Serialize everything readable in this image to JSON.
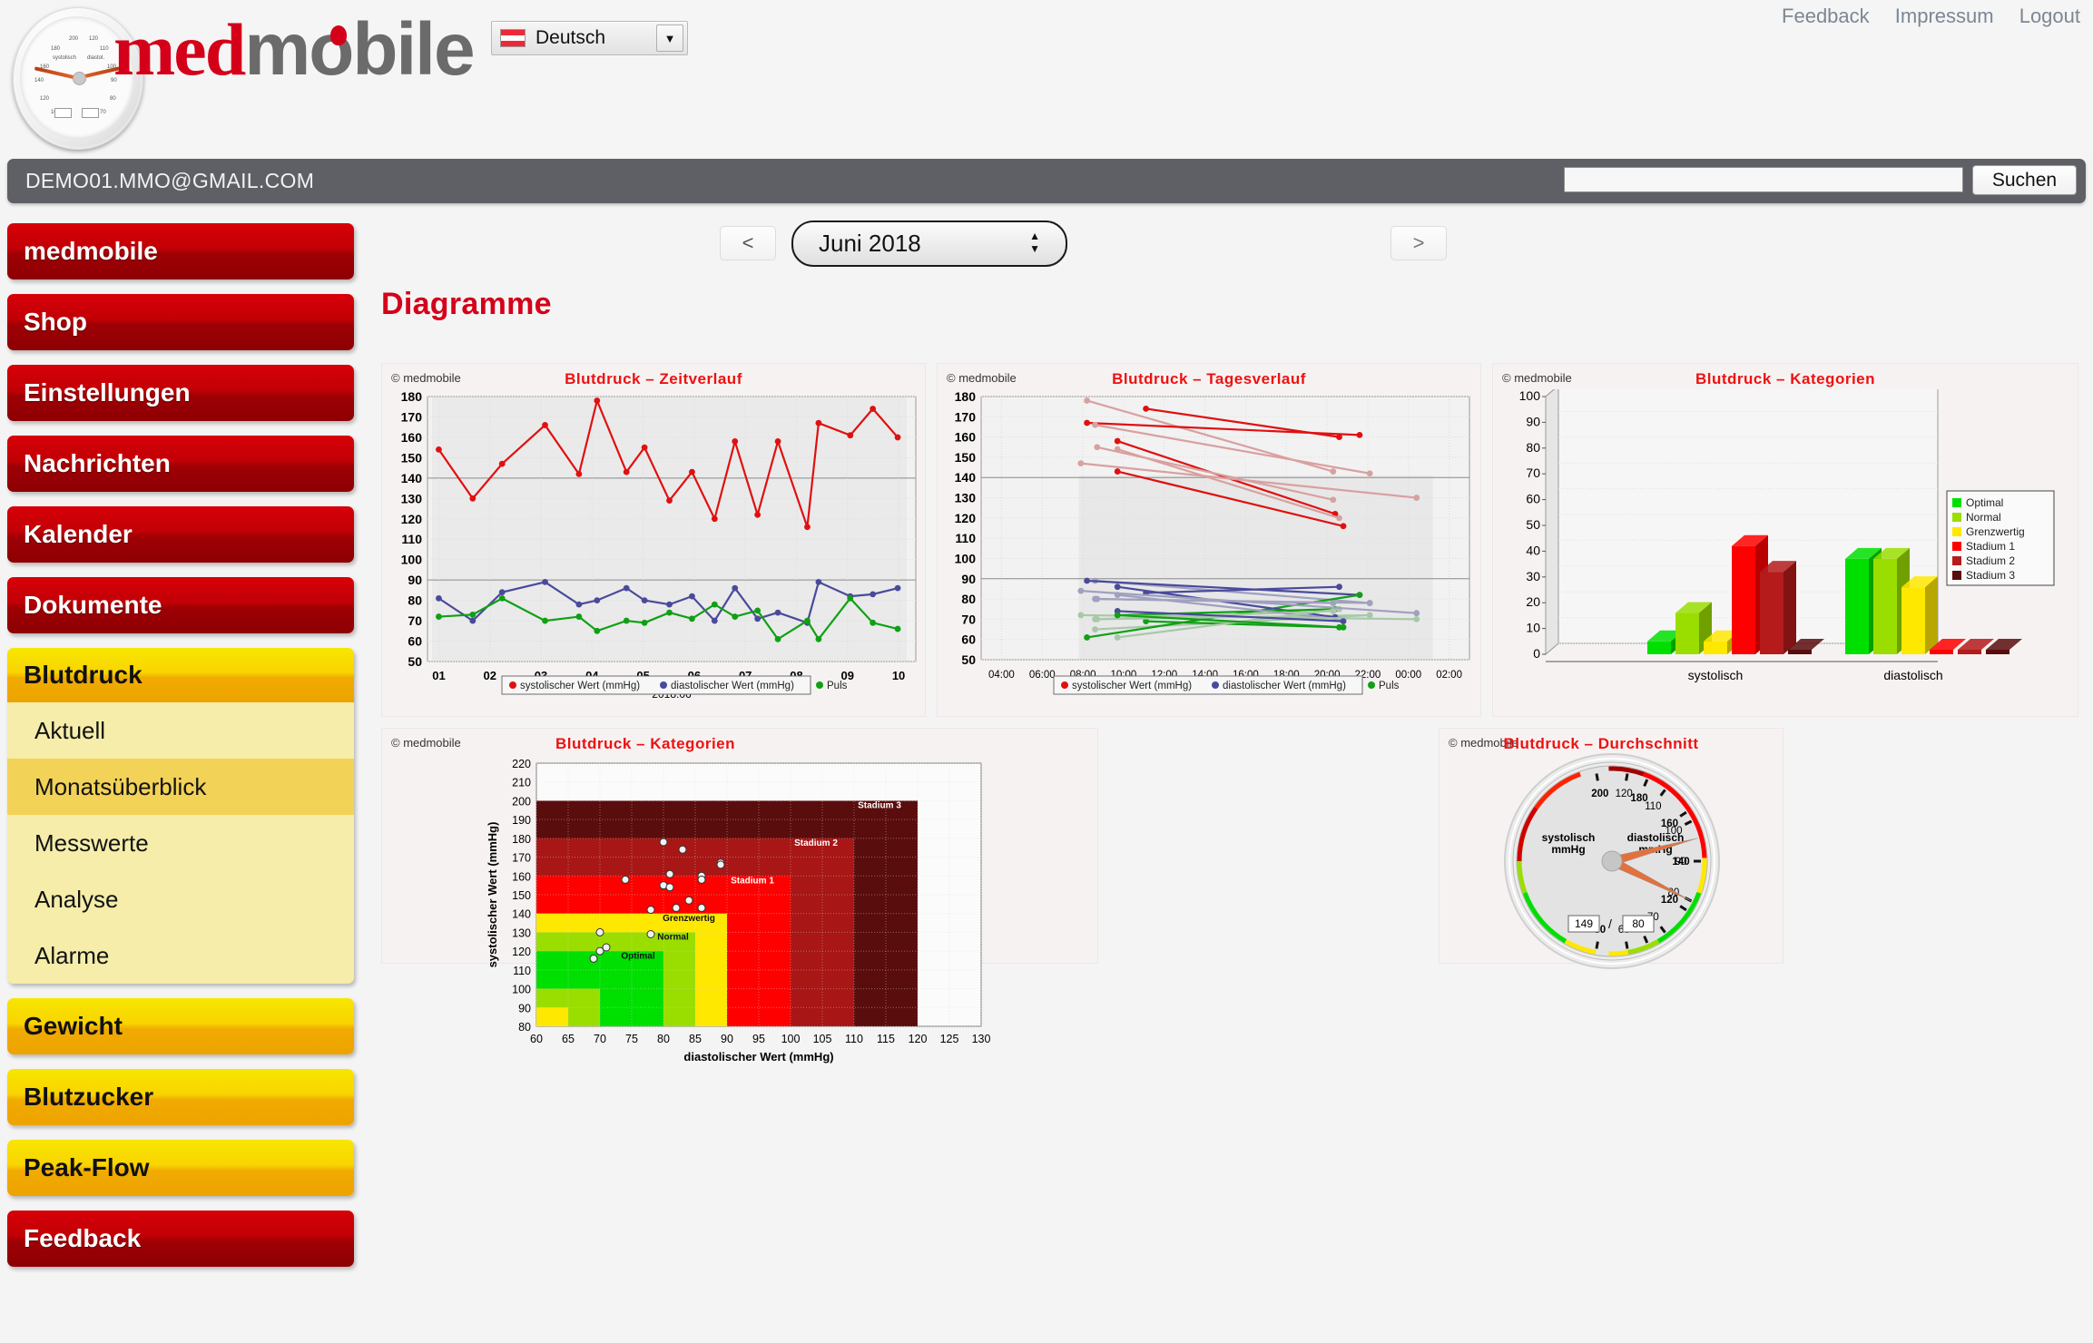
{
  "header": {
    "brand_med": "med",
    "brand_mobile": "mobile",
    "language": "Deutsch",
    "language_flag": "austria-flag",
    "links": [
      {
        "label": "Feedback"
      },
      {
        "label": "Impressum"
      },
      {
        "label": "Logout"
      }
    ]
  },
  "userbar": {
    "email": "DEMO01.MMO@GMAIL.COM",
    "search_value": "",
    "search_placeholder": "",
    "search_button": "Suchen"
  },
  "sidebar": {
    "items": [
      {
        "label": "medmobile",
        "style": "red"
      },
      {
        "label": "Shop",
        "style": "red"
      },
      {
        "label": "Einstellungen",
        "style": "red"
      },
      {
        "label": "Nachrichten",
        "style": "red"
      },
      {
        "label": "Kalender",
        "style": "red"
      },
      {
        "label": "Dokumente",
        "style": "red"
      }
    ],
    "group": {
      "label": "Blutdruck",
      "subitems": [
        {
          "label": "Aktuell",
          "active": false
        },
        {
          "label": "Monatsüberblick",
          "active": true
        },
        {
          "label": "Messwerte",
          "active": false
        },
        {
          "label": "Analyse",
          "active": false
        },
        {
          "label": "Alarme",
          "active": false
        }
      ]
    },
    "items_after": [
      {
        "label": "Gewicht",
        "style": "yellow"
      },
      {
        "label": "Blutzucker",
        "style": "yellow"
      },
      {
        "label": "Peak-Flow",
        "style": "yellow"
      },
      {
        "label": "Feedback",
        "style": "red"
      }
    ]
  },
  "main": {
    "prev_label": "<",
    "next_label": ">",
    "month": "Juni 2018",
    "page_title": "Diagramme",
    "copyright": "© medmobile"
  },
  "colors": {
    "systolic": "#e01010",
    "diastolic": "#4a4a9c",
    "pulse": "#0fa014",
    "brand_red": "#d4001a",
    "accent_yellow": "#f9d400",
    "optimal": "#00e000",
    "normal": "#9ade00",
    "grenzwertig": "#ffe800",
    "stadium1": "#ff0000",
    "stadium2": "#a81414",
    "stadium3": "#550a0a"
  },
  "chart_data": [
    {
      "type": "line",
      "title": "Blutdruck – Zeitverlauf",
      "xlabel": "2018.06",
      "ylabel": "",
      "ylim": [
        50,
        180
      ],
      "yticks": [
        50,
        60,
        70,
        80,
        90,
        100,
        110,
        120,
        130,
        140,
        150,
        160,
        170,
        180
      ],
      "xticks": [
        "01",
        "02",
        "03",
        "04",
        "05",
        "06",
        "07",
        "08",
        "09",
        "10"
      ],
      "grid": true,
      "reference_lines": [
        140,
        90
      ],
      "legend_position": "bottom",
      "x": [
        0.25,
        1.0,
        1.65,
        2.6,
        3.35,
        3.75,
        4.4,
        4.8,
        5.35,
        5.85,
        6.35,
        6.8,
        7.3,
        7.75,
        8.4,
        8.65,
        9.35,
        9.85,
        10.4
      ],
      "series": [
        {
          "name": "systolischer Wert (mmHg)",
          "color": "#e01010",
          "values": [
            154,
            130,
            147,
            166,
            142,
            178,
            143,
            155,
            129,
            143,
            120,
            158,
            122,
            158,
            116,
            167,
            161,
            174,
            160
          ]
        },
        {
          "name": "diastolischer Wert (mmHg)",
          "color": "#4a4a9c",
          "values": [
            81,
            70,
            84,
            89,
            78,
            80,
            86,
            80,
            78,
            82,
            70,
            86,
            71,
            74,
            69,
            89,
            82,
            83,
            86
          ]
        },
        {
          "name": "Puls",
          "color": "#0fa014",
          "values": [
            72,
            73,
            81,
            70,
            72,
            65,
            70,
            69,
            74,
            71,
            78,
            72,
            75,
            61,
            70,
            61,
            81,
            69,
            66
          ]
        }
      ]
    },
    {
      "type": "line",
      "title": "Blutdruck – Tagesverlauf",
      "xlabel": "",
      "ylim": [
        50,
        180
      ],
      "yticks": [
        50,
        60,
        70,
        80,
        90,
        100,
        110,
        120,
        130,
        140,
        150,
        160,
        170,
        180
      ],
      "xticks": [
        "04:00",
        "06:00",
        "08:00",
        "10:00",
        "12:00",
        "14:00",
        "16:00",
        "18:00",
        "20:00",
        "22:00",
        "00:00",
        "02:00"
      ],
      "grid": true,
      "reference_lines": [
        140,
        90
      ],
      "legend_position": "bottom",
      "legend_entries": [
        "systolischer Wert (mmHg)",
        "diastolischer Wert (mmHg)",
        "Puls"
      ],
      "day_lines": [
        {
          "sys": [
            [
              8.2,
              178
            ],
            [
              20.3,
              143
            ]
          ],
          "dia": [
            [
              8.6,
              89
            ],
            [
              22.1,
              78
            ]
          ],
          "pul": [
            [
              8.6,
              65
            ],
            [
              22.1,
              72
            ]
          ],
          "faded": true
        },
        {
          "sys": [
            [
              11.1,
              174
            ],
            [
              20.6,
              160
            ]
          ],
          "dia": [
            [
              11.1,
              83
            ],
            [
              20.6,
              86
            ]
          ],
          "pul": [
            [
              11.1,
              69
            ],
            [
              20.6,
              66
            ]
          ],
          "faded": false
        },
        {
          "sys": [
            [
              8.2,
              167
            ],
            [
              21.6,
              161
            ]
          ],
          "dia": [
            [
              8.2,
              89
            ],
            [
              21.6,
              82
            ]
          ],
          "pul": [
            [
              8.2,
              61
            ],
            [
              21.6,
              82
            ]
          ],
          "faded": false
        },
        {
          "sys": [
            [
              8.6,
              166
            ],
            [
              22.1,
              142
            ]
          ],
          "dia": [
            [
              8.6,
              80
            ],
            [
              22.1,
              78
            ]
          ],
          "pul": [
            [
              8.6,
              70
            ],
            [
              22.1,
              72
            ]
          ],
          "faded": true
        },
        {
          "sys": [
            [
              9.7,
              158
            ],
            [
              20.4,
              122
            ]
          ],
          "dia": [
            [
              9.7,
              86
            ],
            [
              20.4,
              71
            ]
          ],
          "pul": [
            [
              9.7,
              72
            ],
            [
              20.4,
              75
            ]
          ],
          "faded": false
        },
        {
          "sys": [
            [
              8.7,
              155
            ],
            [
              20.3,
              129
            ]
          ],
          "dia": [
            [
              8.7,
              80
            ],
            [
              20.3,
              78
            ]
          ],
          "pul": [
            [
              8.7,
              70
            ],
            [
              20.3,
              74
            ]
          ],
          "faded": true
        },
        {
          "sys": [
            [
              9.7,
              154
            ],
            [
              20.6,
              120
            ]
          ],
          "dia": [
            [
              9.7,
              82
            ],
            [
              20.6,
              70
            ]
          ],
          "pul": [
            [
              9.7,
              61
            ],
            [
              20.6,
              75
            ]
          ],
          "faded": true
        },
        {
          "sys": [
            [
              7.9,
              147
            ],
            [
              0.4,
              130
            ]
          ],
          "dia": [
            [
              7.9,
              84
            ],
            [
              0.4,
              73
            ]
          ],
          "pul": [
            [
              7.9,
              72
            ],
            [
              0.4,
              70
            ]
          ],
          "faded": true
        },
        {
          "sys": [
            [
              9.7,
              143
            ],
            [
              20.8,
              116
            ]
          ],
          "dia": [
            [
              9.7,
              74
            ],
            [
              20.8,
              69
            ]
          ],
          "pul": [
            [
              9.7,
              72
            ],
            [
              20.8,
              66
            ]
          ],
          "faded": false
        }
      ],
      "series": [
        {
          "name": "systolischer Wert (mmHg)",
          "color": "#e01010"
        },
        {
          "name": "diastolischer Wert (mmHg)",
          "color": "#4a4a9c"
        },
        {
          "name": "Puls",
          "color": "#0fa014"
        }
      ]
    },
    {
      "type": "bar",
      "title": "Blutdruck – Kategorien",
      "ylim": [
        0,
        100
      ],
      "yticks": [
        0,
        10,
        20,
        30,
        40,
        50,
        60,
        70,
        80,
        90,
        100
      ],
      "categories": [
        "systolisch",
        "diastolisch"
      ],
      "grid": true,
      "legend_position": "right",
      "series": [
        {
          "name": "Optimal",
          "color": "#00e000",
          "values": [
            5,
            37
          ]
        },
        {
          "name": "Normal",
          "color": "#9ade00",
          "values": [
            16,
            37
          ]
        },
        {
          "name": "Grenzwertig",
          "color": "#ffe800",
          "values": [
            5,
            26
          ]
        },
        {
          "name": "Stadium 1",
          "color": "#ff0000",
          "values": [
            42,
            0
          ]
        },
        {
          "name": "Stadium 2",
          "color": "#b51b1b",
          "values": [
            32,
            0
          ]
        },
        {
          "name": "Stadium 3",
          "color": "#5a0d0d",
          "values": [
            0,
            0
          ]
        }
      ]
    },
    {
      "type": "scatter",
      "title": "Blutdruck – Kategorien",
      "xlabel": "diastolischer Wert (mmHg)",
      "ylabel": "systolischer Wert (mmHg)",
      "xlim": [
        60,
        130
      ],
      "ylim": [
        80,
        220
      ],
      "xticks": [
        60,
        65,
        70,
        75,
        80,
        85,
        90,
        95,
        100,
        105,
        110,
        115,
        120,
        125,
        130
      ],
      "yticks": [
        80,
        90,
        100,
        110,
        120,
        130,
        140,
        150,
        160,
        170,
        180,
        190,
        200,
        210,
        220
      ],
      "grid": true,
      "zones": [
        {
          "label": "Stadium 3",
          "xmax": 120,
          "ymax": 200,
          "color": "#5a0d0d"
        },
        {
          "label": "Stadium 2",
          "xmax": 110,
          "ymax": 180,
          "color": "#a81616"
        },
        {
          "label": "Stadium 1",
          "xmax": 100,
          "ymax": 160,
          "color": "#ff0000"
        },
        {
          "label": "Grenzwertig",
          "xmax": 90,
          "ymax": 140,
          "color": "#ffe800"
        },
        {
          "label": "Normal",
          "xmax": 85,
          "ymax": 130,
          "color": "#9ade00"
        },
        {
          "label": "Optimal",
          "xmax": 80,
          "ymax": 120,
          "color": "#00e000"
        }
      ],
      "points": [
        [
          80,
          178
        ],
        [
          83,
          174
        ],
        [
          89,
          167
        ],
        [
          89,
          166
        ],
        [
          74,
          158
        ],
        [
          86,
          160
        ],
        [
          86,
          158
        ],
        [
          81,
          161
        ],
        [
          80,
          155
        ],
        [
          81,
          154
        ],
        [
          84,
          147
        ],
        [
          82,
          143
        ],
        [
          86,
          143
        ],
        [
          78,
          142
        ],
        [
          70,
          130
        ],
        [
          78,
          129
        ],
        [
          71,
          122
        ],
        [
          70,
          120
        ],
        [
          69,
          116
        ]
      ]
    },
    {
      "type": "gauge",
      "title": "Blutdruck – Durchschnitt",
      "systolic_label": "systolisch\nmmHg",
      "diastolic_label": "diastolisch\nmmHg",
      "systolic_value": 149,
      "diastolic_value": 80,
      "separator": "/",
      "systolic_ticks": [
        80,
        100,
        120,
        140,
        160,
        180,
        200
      ],
      "diastolic_ticks": [
        60,
        70,
        80,
        90,
        100,
        110,
        120
      ]
    }
  ]
}
